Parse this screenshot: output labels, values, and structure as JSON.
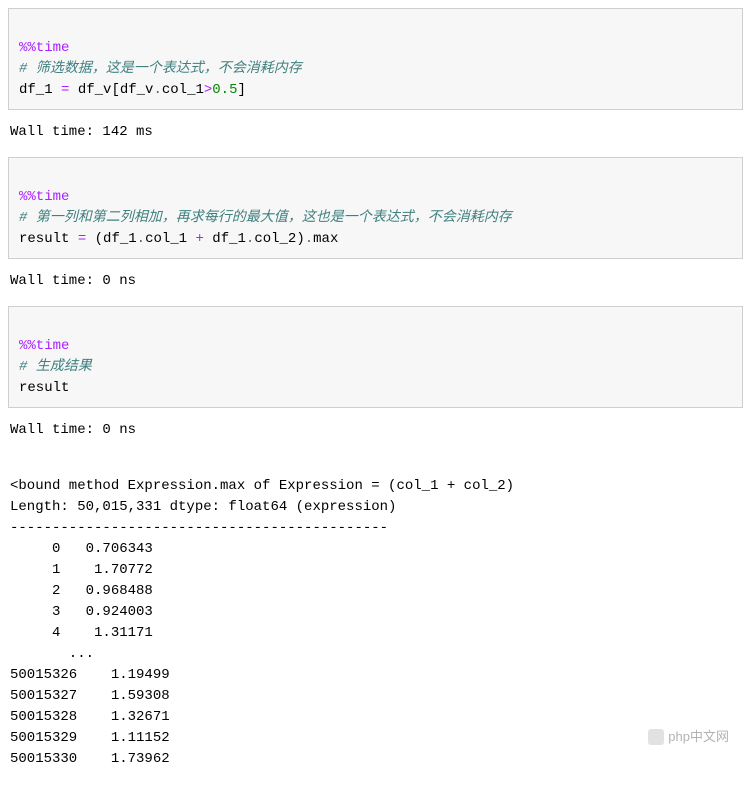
{
  "cells": [
    {
      "magic": "%%time",
      "comment": "# 筛选数据，这是一个表达式，不会消耗内存",
      "code_tokens": {
        "a": "df_1",
        "eq": " = ",
        "b": "df_v",
        "lb": "[",
        "c": "df_v",
        "d1": ".",
        "col1": "col_1",
        "gt": ">",
        "num": "0.5",
        "rb": "]"
      },
      "output": "Wall time: 142 ms"
    },
    {
      "magic": "%%time",
      "comment": "# 第一列和第二列相加，再求每行的最大值，这也是一个表达式，不会消耗内存",
      "code_tokens": {
        "a": "result",
        "eq": " = ",
        "lp": "(",
        "b": "df_1",
        "d1": ".",
        "col1": "col_1",
        "plus": " + ",
        "c": "df_1",
        "d2": ".",
        "col2": "col_2",
        "rp": ")",
        "d3": ".",
        "max": "max"
      },
      "output": "Wall time: 0 ns"
    },
    {
      "magic": "%%time",
      "comment": "# 生成结果",
      "code_tokens": {
        "a": "result"
      },
      "output": "Wall time: 0 ns"
    }
  ],
  "expr_output": {
    "line1": "<bound method Expression.max of Expression = (col_1 + col_2)",
    "line2": "Length: 50,015,331 dtype: float64 (expression)",
    "dashes": "---------------------------------------------",
    "rows_head": [
      "     0   0.706343",
      "     1    1.70772",
      "     2   0.968488",
      "     3   0.924003",
      "     4    1.31171",
      "       ...       "
    ],
    "rows_tail": [
      "50015326    1.19499",
      "50015327    1.59308",
      "50015328    1.32671",
      "50015329    1.11152",
      "50015330    1.73962"
    ]
  },
  "chart_data": {
    "type": "table",
    "title": "Expression.max of (col_1 + col_2)",
    "length": 50015331,
    "dtype": "float64",
    "head": {
      "index": [
        0,
        1,
        2,
        3,
        4
      ],
      "values": [
        0.706343,
        1.70772,
        0.968488,
        0.924003,
        1.31171
      ]
    },
    "tail": {
      "index": [
        50015326,
        50015327,
        50015328,
        50015329,
        50015330
      ],
      "values": [
        1.19499,
        1.59308,
        1.32671,
        1.11152,
        1.73962
      ]
    }
  },
  "watermark": "php中文网"
}
